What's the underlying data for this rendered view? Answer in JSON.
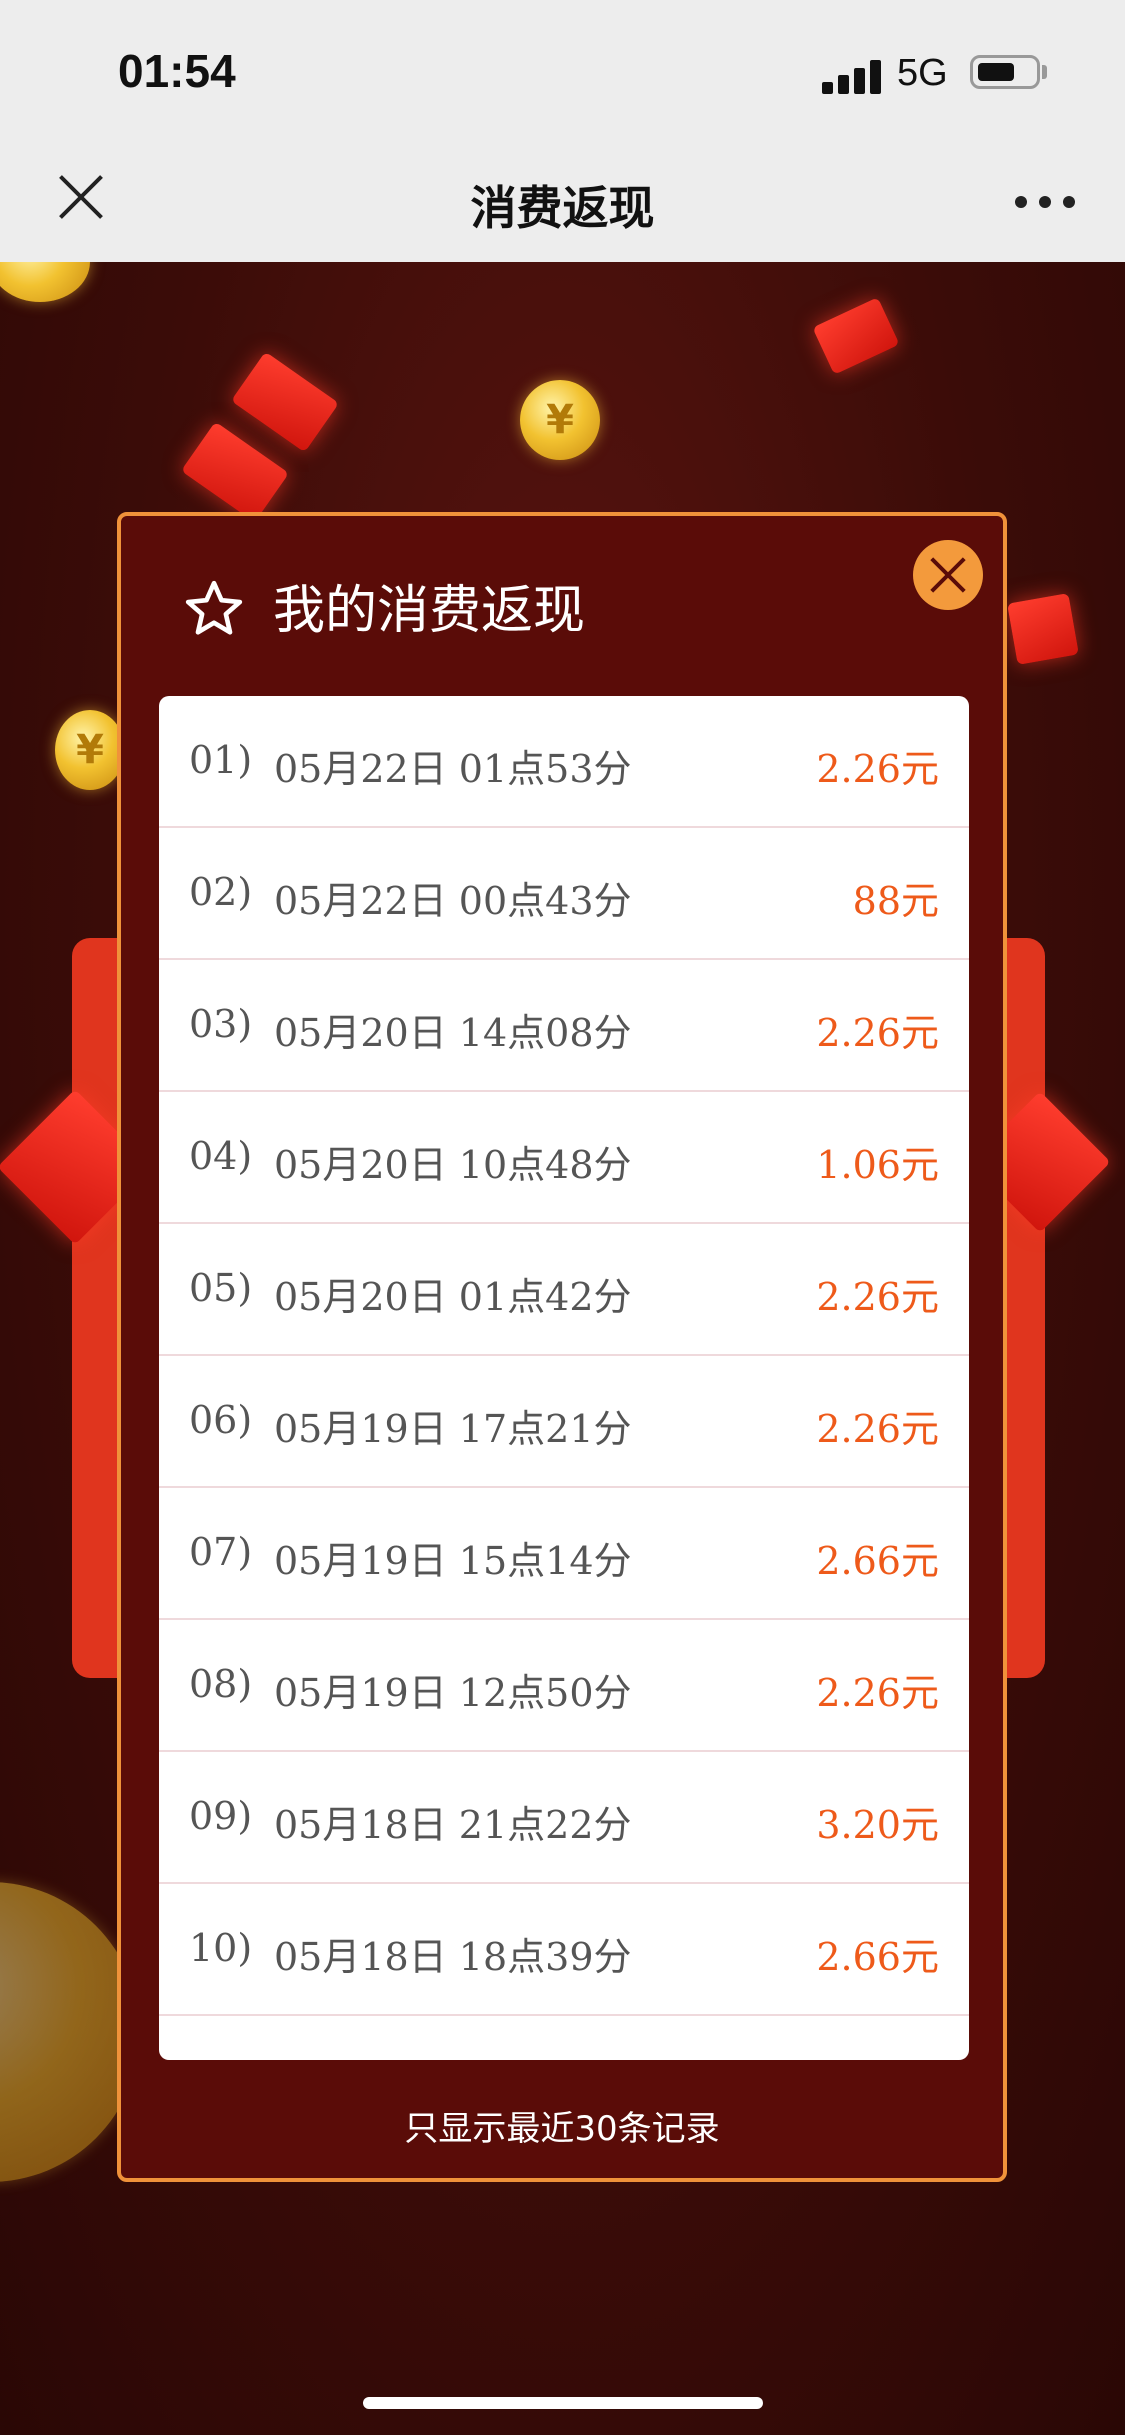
{
  "status_bar": {
    "time": "01:54",
    "network": "5G"
  },
  "nav": {
    "title": "消费返现",
    "close_icon": "close-icon",
    "more_icon": "more-icon"
  },
  "dialog": {
    "title": "我的消费返现",
    "title_icon": "star-icon",
    "close_icon": "close-icon",
    "records": [
      {
        "index": "01)",
        "time": "05月22日 01点53分",
        "amount": "2.26元"
      },
      {
        "index": "02)",
        "time": "05月22日 00点43分",
        "amount": "88元"
      },
      {
        "index": "03)",
        "time": "05月20日 14点08分",
        "amount": "2.26元"
      },
      {
        "index": "04)",
        "time": "05月20日 10点48分",
        "amount": "1.06元"
      },
      {
        "index": "05)",
        "time": "05月20日 01点42分",
        "amount": "2.26元"
      },
      {
        "index": "06)",
        "time": "05月19日 17点21分",
        "amount": "2.26元"
      },
      {
        "index": "07)",
        "time": "05月19日 15点14分",
        "amount": "2.66元"
      },
      {
        "index": "08)",
        "time": "05月19日 12点50分",
        "amount": "2.26元"
      },
      {
        "index": "09)",
        "time": "05月18日 21点22分",
        "amount": "3.20元"
      },
      {
        "index": "10)",
        "time": "05月18日 18点39分",
        "amount": "2.66元"
      }
    ],
    "footer": "只显示最近30条记录"
  },
  "colors": {
    "accent": "#f0923a",
    "amount": "#ee5a1a",
    "dialog_bg": "#5a0c08"
  }
}
